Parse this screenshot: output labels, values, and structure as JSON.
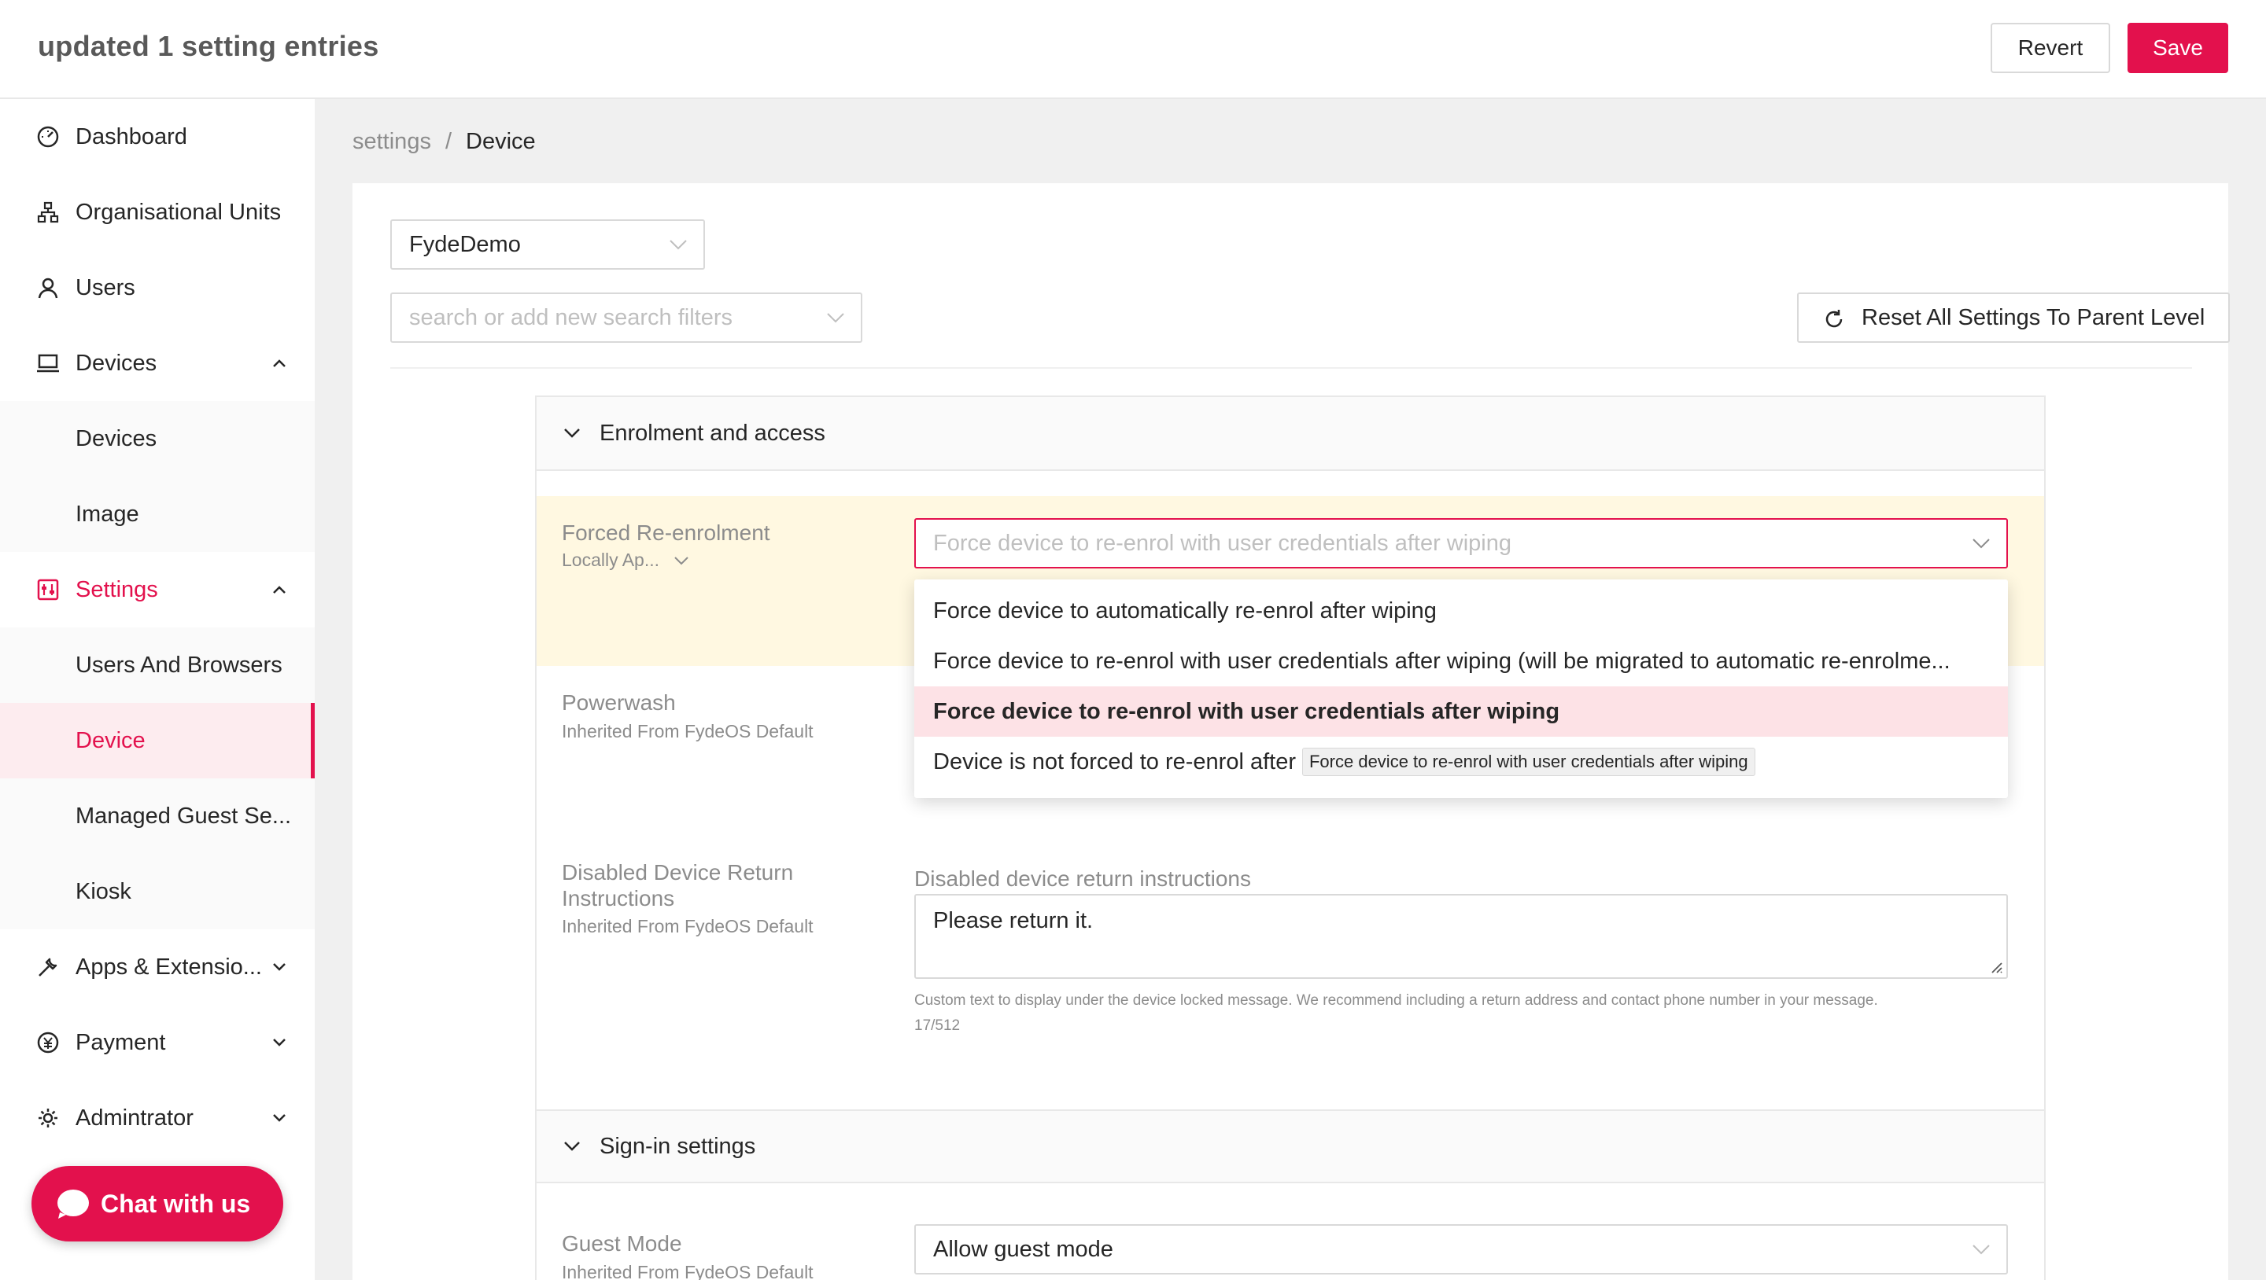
{
  "header": {
    "title": "updated 1 setting entries",
    "revert_label": "Revert",
    "save_label": "Save"
  },
  "sidebar": {
    "items": [
      {
        "label": "Dashboard",
        "icon": "dashboard-icon"
      },
      {
        "label": "Organisational Units",
        "icon": "org-units-icon"
      },
      {
        "label": "Users",
        "icon": "user-icon"
      },
      {
        "label": "Devices",
        "icon": "laptop-icon",
        "expanded": true
      },
      {
        "label": "Devices"
      },
      {
        "label": "Image"
      },
      {
        "label": "Settings",
        "icon": "settings-icon",
        "expanded": true
      },
      {
        "label": "Users And Browsers"
      },
      {
        "label": "Device",
        "selected": true
      },
      {
        "label": "Managed Guest Se..."
      },
      {
        "label": "Kiosk"
      },
      {
        "label": "Apps & Extensio...",
        "icon": "wrench-icon"
      },
      {
        "label": "Payment",
        "icon": "payment-icon"
      },
      {
        "label": "Admintrator",
        "icon": "gear-icon"
      }
    ],
    "chat_label": "Chat with us"
  },
  "breadcrumb": {
    "root": "settings",
    "separator": "/",
    "current": "Device"
  },
  "filters": {
    "org_unit": "FydeDemo",
    "search_placeholder": "search or add new search filters",
    "reset_label": "Reset All Settings To Parent Level"
  },
  "sections": {
    "enrolment": {
      "title": "Enrolment and access",
      "forced_reenrolment": {
        "label": "Forced Re-enrolment",
        "source": "Locally Ap...",
        "value": "Force device to re-enrol with user credentials after wiping",
        "options": [
          "Force device to automatically re-enrol after wiping",
          "Force device to re-enrol with user credentials after wiping (will be migrated to automatic re-enrolme...",
          "Force device to re-enrol with user credentials after wiping",
          "Device is not forced to re-enrol after"
        ],
        "selected_index": 2,
        "tooltip": "Force device to re-enrol with user credentials after wiping"
      },
      "powerwash": {
        "label": "Powerwash",
        "source": "Inherited From FydeOS Default"
      },
      "disabled_return": {
        "label": "Disabled Device Return Instructions",
        "source": "Inherited From FydeOS Default",
        "field_label": "Disabled device return instructions",
        "value": "Please return it.",
        "help": "Custom text to display under the device locked message. We recommend including a return address and contact phone number in your message.",
        "count": "17/512"
      }
    },
    "signin": {
      "title": "Sign-in settings",
      "guest_mode": {
        "label": "Guest Mode",
        "source": "Inherited From FydeOS Default",
        "value": "Allow guest mode"
      }
    }
  },
  "colors": {
    "accent": "#e3114d",
    "highlight_row": "#fff8e1",
    "selected_option": "#fde2e6"
  }
}
